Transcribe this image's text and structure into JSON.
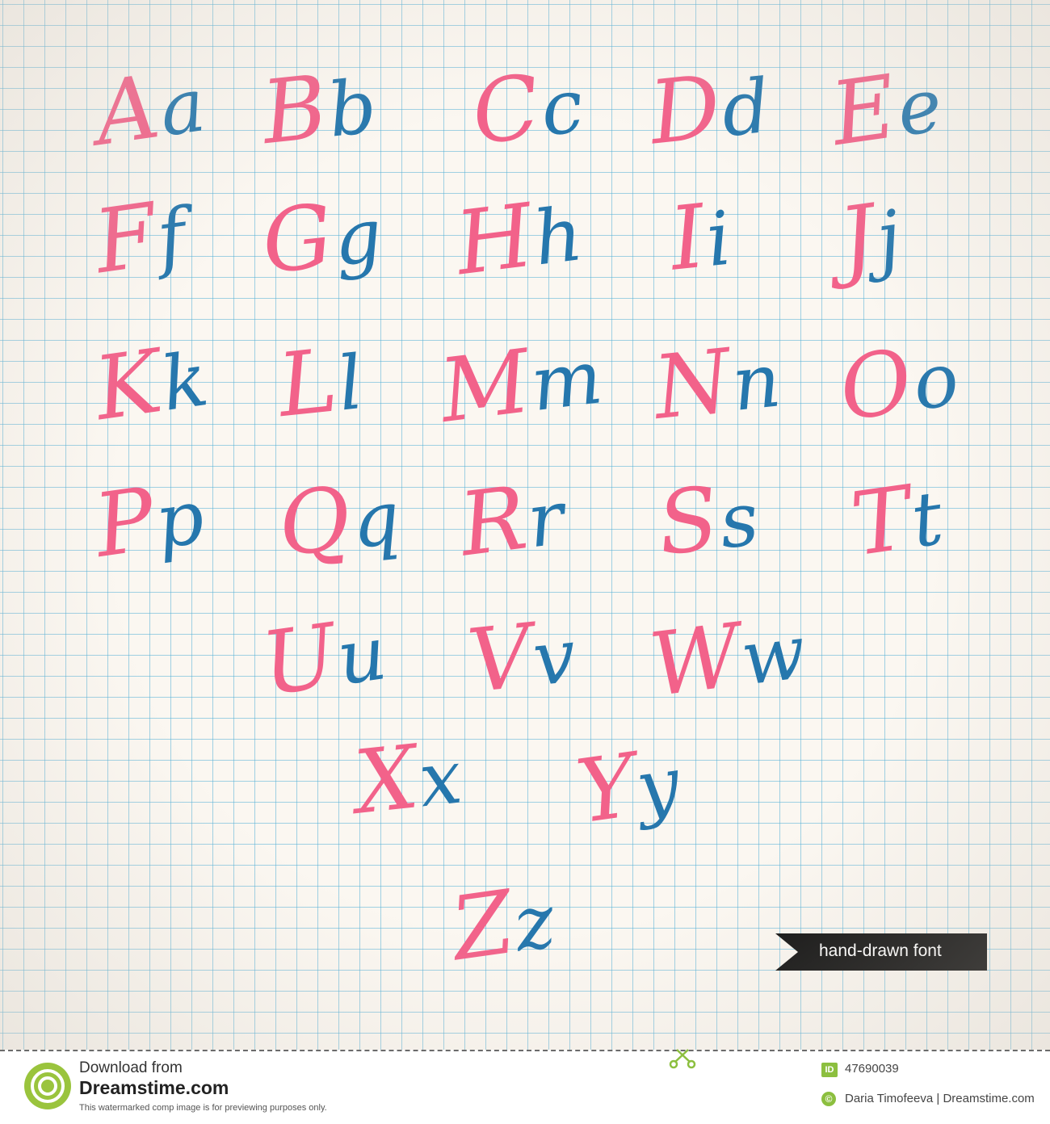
{
  "letters": [
    {
      "upper": "A",
      "lower": "a"
    },
    {
      "upper": "B",
      "lower": "b"
    },
    {
      "upper": "C",
      "lower": "c"
    },
    {
      "upper": "D",
      "lower": "d"
    },
    {
      "upper": "E",
      "lower": "e"
    },
    {
      "upper": "F",
      "lower": "f"
    },
    {
      "upper": "G",
      "lower": "g"
    },
    {
      "upper": "H",
      "lower": "h"
    },
    {
      "upper": "I",
      "lower": "i"
    },
    {
      "upper": "J",
      "lower": "j"
    },
    {
      "upper": "K",
      "lower": "k"
    },
    {
      "upper": "L",
      "lower": "l"
    },
    {
      "upper": "M",
      "lower": "m"
    },
    {
      "upper": "N",
      "lower": "n"
    },
    {
      "upper": "O",
      "lower": "o"
    },
    {
      "upper": "P",
      "lower": "p"
    },
    {
      "upper": "Q",
      "lower": "q"
    },
    {
      "upper": "R",
      "lower": "r"
    },
    {
      "upper": "S",
      "lower": "s"
    },
    {
      "upper": "T",
      "lower": "t"
    },
    {
      "upper": "U",
      "lower": "u"
    },
    {
      "upper": "V",
      "lower": "v"
    },
    {
      "upper": "W",
      "lower": "w"
    },
    {
      "upper": "X",
      "lower": "x"
    },
    {
      "upper": "Y",
      "lower": "y"
    },
    {
      "upper": "Z",
      "lower": "z"
    }
  ],
  "ribbon_label": "hand-drawn font",
  "colors": {
    "uppercase": "#f2628a",
    "lowercase": "#2677ad",
    "grid": "#54b0d6",
    "paper": "#fbf7f1"
  },
  "footer": {
    "download_label": "Download from",
    "site_label": "Dreamstime.com",
    "watermark_note": "This watermarked comp image is for previewing purposes only.",
    "id_badge": "ID",
    "image_id": "47690039",
    "credit": "Daria Timofeeva | Dreamstime.com",
    "icons": [
      "dreamstime-logo-icon",
      "scissors-icon",
      "id-badge-icon",
      "copyright-icon"
    ]
  }
}
